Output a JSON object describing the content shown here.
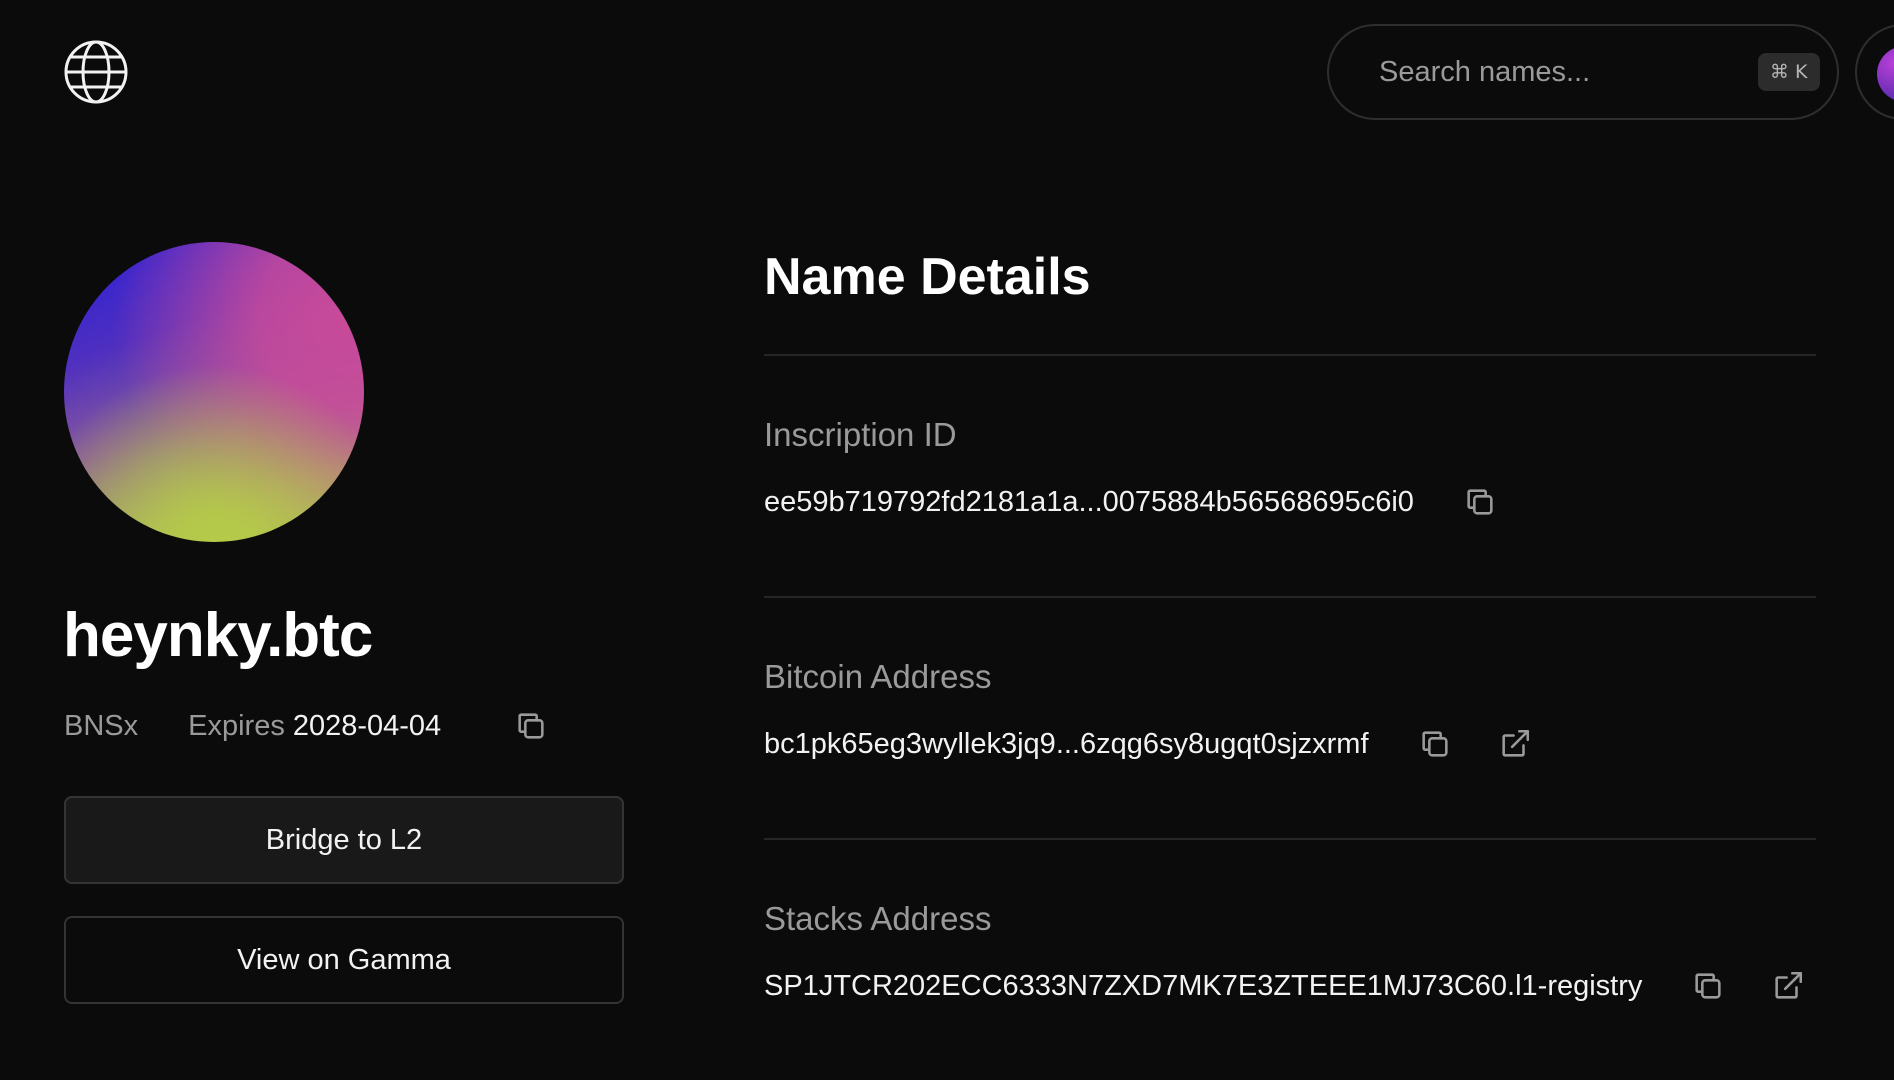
{
  "header": {
    "logo_icon": "globe-icon",
    "search": {
      "placeholder": "Search names...",
      "shortcut": "⌘ K"
    }
  },
  "profile": {
    "name": "heynky.btc",
    "namespace": "BNSx",
    "expires_label": "Expires",
    "expires_date": "2028-04-04",
    "avatar_colors": [
      "#2a1fd6",
      "#c94a9a",
      "#b5cb48"
    ]
  },
  "actions": {
    "bridge_label": "Bridge to L2",
    "gamma_label": "View on Gamma"
  },
  "details": {
    "title": "Name Details",
    "inscription": {
      "label": "Inscription ID",
      "value": "ee59b719792fd2181a1a...0075884b56568695c6i0"
    },
    "bitcoin": {
      "label": "Bitcoin Address",
      "value": "bc1pk65eg3wyllek3jq9...6zqg6sy8ugqt0sjzxrmf"
    },
    "stacks": {
      "label": "Stacks Address",
      "value": "SP1JTCR202ECC6333N7ZXD7MK7E3ZTEEE1MJ73C60.l1-registry"
    }
  },
  "colors": {
    "background": "#0b0b0b",
    "text": "#f2f2f2",
    "muted": "#9a9a9a",
    "border": "#343434"
  }
}
